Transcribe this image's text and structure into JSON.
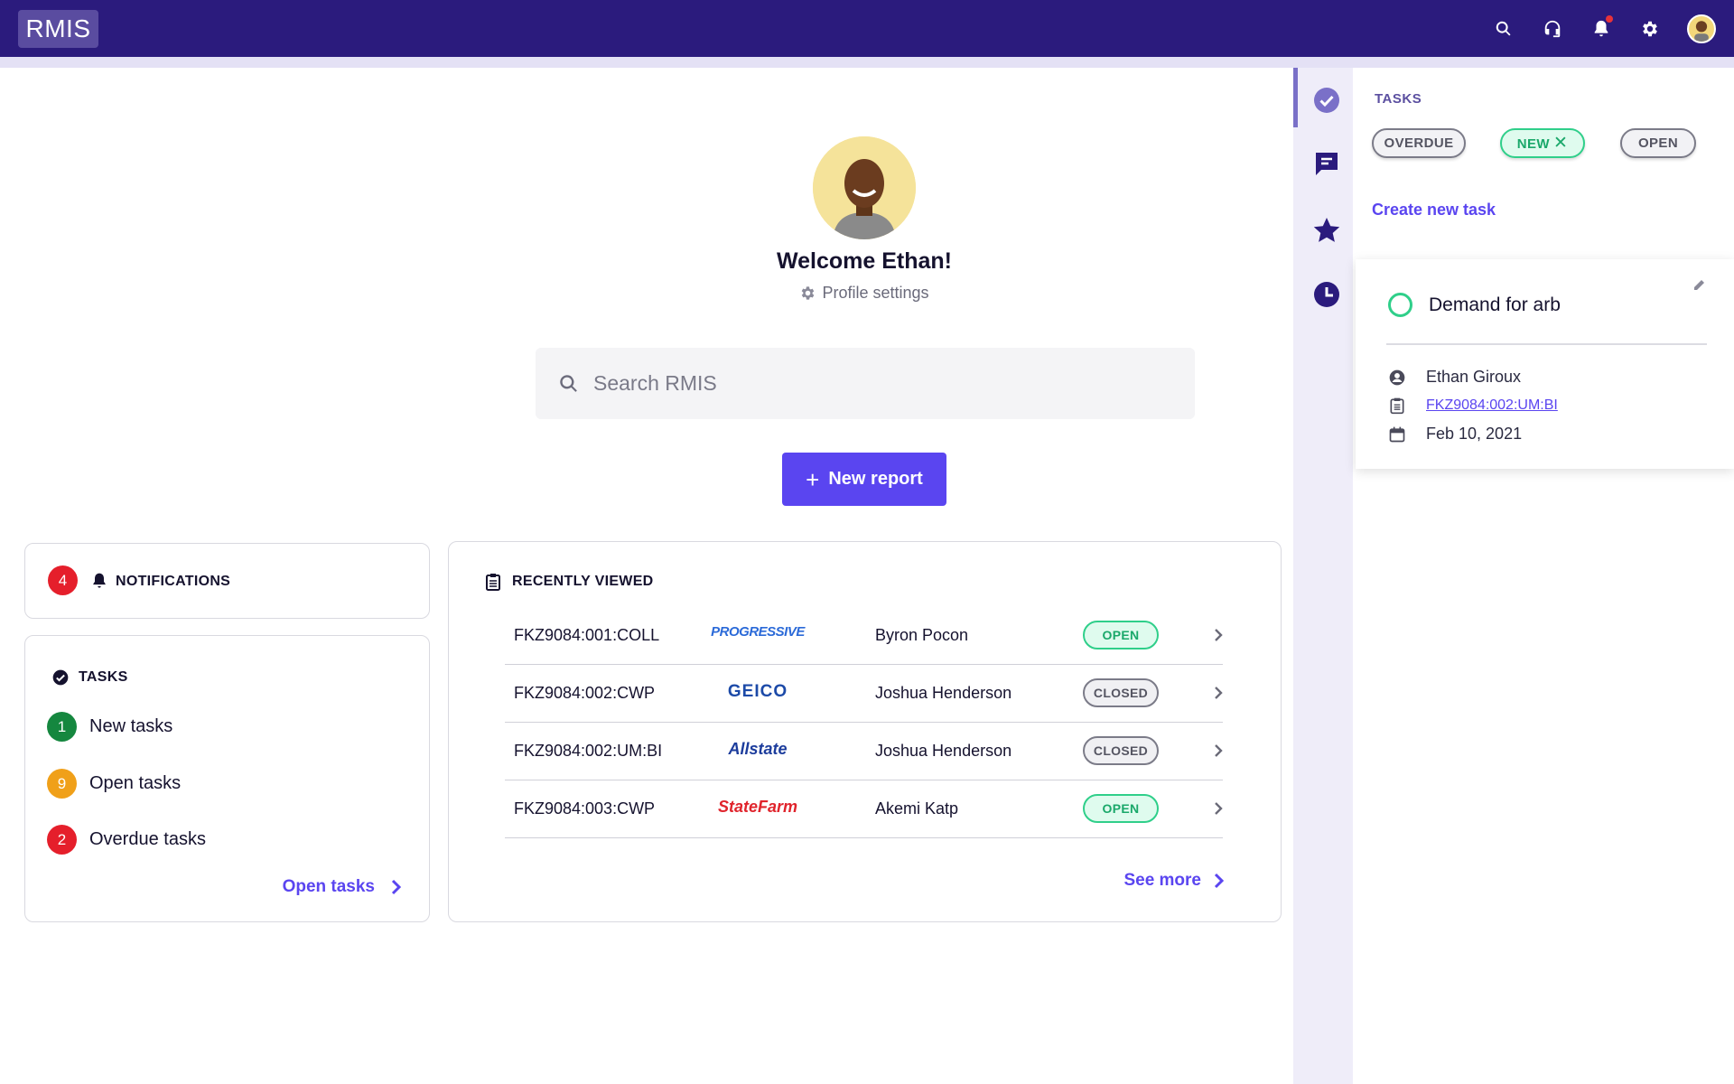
{
  "app": {
    "logo": "RMIS"
  },
  "topbar": {
    "icons": [
      "search-icon",
      "support-headset-icon",
      "bell-icon",
      "gear-icon",
      "user-avatar"
    ],
    "notification_dot_color": "#e8323a"
  },
  "profile": {
    "welcome": "Welcome Ethan!",
    "settings_label": "Profile settings"
  },
  "search": {
    "placeholder": "Search RMIS"
  },
  "new_report": {
    "label": "New report"
  },
  "notifications": {
    "count": "4",
    "title": "NOTIFICATIONS"
  },
  "tasks": {
    "title": "TASKS",
    "items": [
      {
        "count": "1",
        "label": "New tasks",
        "color": "#15873f"
      },
      {
        "count": "9",
        "label": "Open tasks",
        "color": "#f0a019"
      },
      {
        "count": "2",
        "label": "Overdue tasks",
        "color": "#e51f2b"
      }
    ],
    "link": "Open tasks"
  },
  "recently_viewed": {
    "title": "RECENTLY VIEWED",
    "rows": [
      {
        "claim": "FKZ9084:001:COLL",
        "carrier": "PROGRESSIVE",
        "carrier_color": "#2b6ad8",
        "person": "Byron Pocon",
        "status": "OPEN"
      },
      {
        "claim": "FKZ9084:002:CWP",
        "carrier": "GEICO",
        "carrier_color": "#1c4aa8",
        "person": "Joshua Henderson",
        "status": "CLOSED"
      },
      {
        "claim": "FKZ9084:002:UM:BI",
        "carrier": "Allstate",
        "carrier_color": "#1c3c9c",
        "person": "Joshua Henderson",
        "status": "CLOSED"
      },
      {
        "claim": "FKZ9084:003:CWP",
        "carrier": "StateFarm",
        "carrier_color": "#e0242c",
        "person": "Akemi Katp",
        "status": "OPEN"
      }
    ],
    "see_more": "See more"
  },
  "side_panel": {
    "rail_icons": [
      "check-circle-icon",
      "message-icon",
      "star-icon",
      "clock-icon"
    ],
    "title": "TASKS",
    "filters": {
      "overdue": "OVERDUE",
      "new": "NEW",
      "open": "OPEN"
    },
    "create_task": "Create new task",
    "task": {
      "title": "Demand for arb",
      "assignee": "Ethan Giroux",
      "claim": "FKZ9084:002:UM:BI",
      "date": "Feb 10, 2021"
    }
  },
  "colors": {
    "topbar": "#2b1b7d",
    "accent": "#5a45f0",
    "open_green": "#2fcf8a"
  }
}
